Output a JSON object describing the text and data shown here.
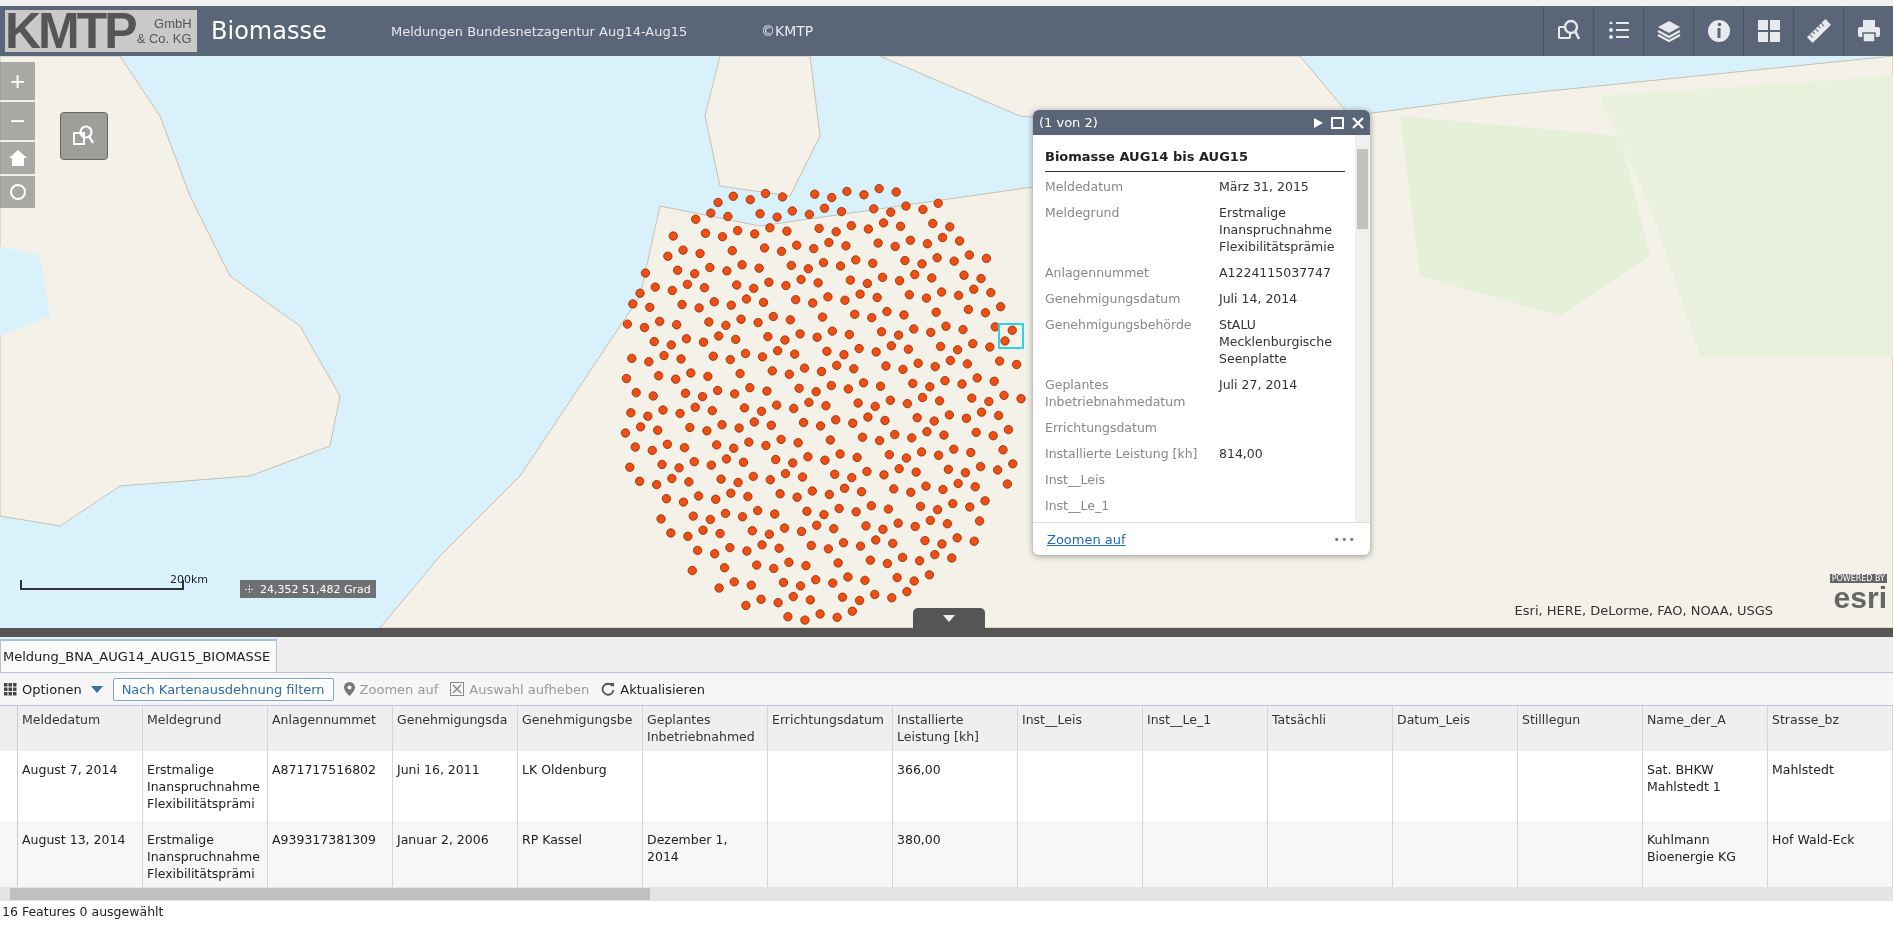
{
  "header": {
    "logo_main": "KMTP",
    "logo_sub": [
      "GmbH",
      "& Co. KG"
    ],
    "title": "Biomasse",
    "subtitle": "Meldungen Bundesnetzagentur Aug14-Aug15",
    "copyright": "©KMTP",
    "tools": [
      {
        "kind": "query"
      },
      {
        "kind": "legend"
      },
      {
        "kind": "layers"
      },
      {
        "kind": "info"
      },
      {
        "kind": "widgets"
      },
      {
        "kind": "measure"
      },
      {
        "kind": "print"
      }
    ]
  },
  "map": {
    "zoom_in": "+",
    "zoom_out": "−",
    "scale_label": "200km",
    "coordinates": "24,352 51,482 Grad",
    "attribution": "Esri, HERE, DeLorme, FAO, NOAA, USGS",
    "esri_powered": "POWERED BY",
    "esri_logo": "esri"
  },
  "popup": {
    "pager": "(1 von 2)",
    "title": "Biomasse AUG14 bis AUG15",
    "zoom_link": "Zoomen auf",
    "more": "•••",
    "fields": [
      {
        "label": "Meldedatum",
        "value": "März 31, 2015"
      },
      {
        "label": "Meldegrund",
        "value": "Erstmalige Inanspruchnahme Flexibilitätsprämie"
      },
      {
        "label": "Anlagennummet",
        "value": "A1224115037747"
      },
      {
        "label": "Genehmigungsdatum",
        "value": "Juli 14, 2014"
      },
      {
        "label": "Genehmigungsbehörde",
        "value": "StALU Mecklenburgische Seenplatte"
      },
      {
        "label": "Geplantes Inbetriebnahmedatum",
        "value": "Juli 27, 2014"
      },
      {
        "label": "Errichtungsdatum"
      },
      {
        "label": "Installierte Leistung [kh]",
        "value": "814,00"
      },
      {
        "label": "Inst__Leis"
      },
      {
        "label": "Inst__Le_1"
      }
    ]
  },
  "table_panel": {
    "tab": {
      "label": "Meldung_BNA_AUG14_AUG15_BIOMASSE",
      "selected": true
    },
    "toolbar": [
      {
        "kind": "options",
        "label": "Optionen",
        "disabled": false
      },
      {
        "kind": "filter",
        "label": "Nach Kartenausdehnung filtern",
        "disabled": false
      },
      {
        "kind": "zoom",
        "label": "Zoomen auf",
        "disabled": true
      },
      {
        "kind": "clear",
        "label": "Auswahl aufheben",
        "disabled": true
      },
      {
        "kind": "refresh",
        "label": "Aktualisieren",
        "disabled": false
      }
    ],
    "columns": [
      "Meldedatum",
      "Meldegrund",
      "Anlagennummet",
      "Genehmigungsda",
      "Genehmigungsbe",
      "Geplantes Inbetriebnahmed",
      "Errichtungsdatum",
      "Installierte Leistung [kh]",
      "Inst__Leis",
      "Inst__Le_1",
      "Tatsächli",
      "Datum_Leis",
      "Stilllegun",
      "Name_der_A",
      "Strasse_bz"
    ],
    "rows": [
      {
        "selected": false,
        "cells": [
          "August 7, 2014",
          "Erstmalige Inanspruchnahme Flexibilitätsprämi",
          "A871717516802",
          "Juni 16, 2011",
          "LK Oldenburg",
          "",
          "",
          "366,00",
          "",
          "",
          "",
          "",
          "",
          "Sat. BHKW Mahlstedt 1",
          "Mahlstedt"
        ]
      },
      {
        "selected": false,
        "cells": [
          "August 13, 2014",
          "Erstmalige Inanspruchnahme Flexibilitätsprämi",
          "A939317381309",
          "Januar 2, 2006",
          "RP Kassel",
          "Dezember 1, 2014",
          "",
          "380,00",
          "",
          "",
          "",
          "",
          "",
          "Kuhlmann Bioenergie KG",
          "Hof Wald-Eck"
        ]
      }
    ],
    "status": "16 Features 0 ausgewählt"
  }
}
